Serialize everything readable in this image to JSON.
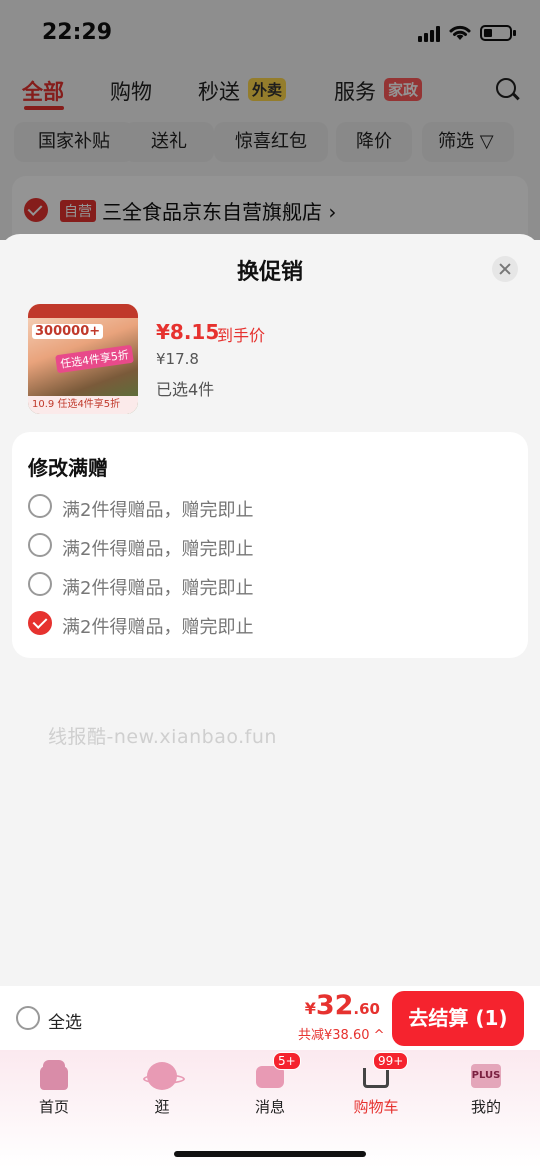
{
  "status_bar": {
    "time": "22:29"
  },
  "top_tabs": {
    "items": [
      {
        "label": "全部"
      },
      {
        "label": "购物"
      },
      {
        "label": "秒送",
        "tag": "外卖"
      },
      {
        "label": "服务",
        "tag": "家政"
      }
    ]
  },
  "filters": [
    "国家补贴",
    "送礼",
    "惊喜红包",
    "降价",
    "筛选"
  ],
  "store": {
    "self_tag": "自营",
    "name": "三全食品京东自营旗舰店",
    "arrow": "›"
  },
  "sheet": {
    "title": "换促销",
    "product": {
      "image_text": {
        "badge": "300000+",
        "banner": "任选4件享5折",
        "footer": "10.9 任选4件享5折"
      },
      "price": "¥8.15",
      "price_label": "到手价",
      "original_price": "¥17.8",
      "selected": "已选4件"
    },
    "gift": {
      "title": "修改满赠",
      "options": [
        {
          "label": "满2件得赠品，赠完即止",
          "checked": false
        },
        {
          "label": "满2件得赠品，赠完即止",
          "checked": false
        },
        {
          "label": "满2件得赠品，赠完即止",
          "checked": false
        },
        {
          "label": "满2件得赠品，赠完即止",
          "checked": true
        }
      ]
    },
    "watermark": "线报酷-new.xianbao.fun"
  },
  "checkout": {
    "select_all": "全选",
    "total_yen": "¥",
    "total_int": "32",
    "total_dec": ".60",
    "saved": "共减¥38.60 ^",
    "pay_button": "去结算 (1)"
  },
  "nav": {
    "items": [
      {
        "label": "首页",
        "icon": "home-icon"
      },
      {
        "label": "逛",
        "icon": "explore-icon"
      },
      {
        "label": "消息",
        "icon": "message-icon",
        "badge": "5+"
      },
      {
        "label": "购物车",
        "icon": "cart-icon",
        "badge": "99+",
        "active": true
      },
      {
        "label": "我的",
        "icon": "plus-member-icon",
        "icon_text": "PLUS"
      }
    ]
  },
  "colors": {
    "accent": "#e6322f",
    "button": "#f5232e"
  }
}
